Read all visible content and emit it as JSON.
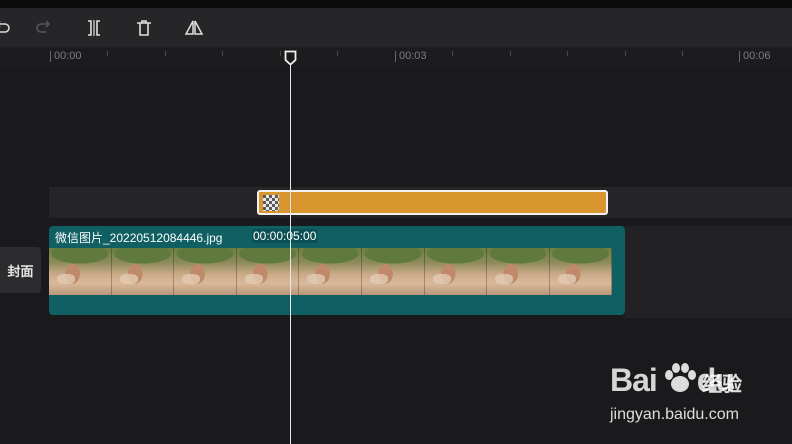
{
  "toolbar": {
    "buttons": [
      {
        "name": "undo",
        "icon": "undo-icon",
        "enabled": true
      },
      {
        "name": "redo",
        "icon": "redo-icon",
        "enabled": false
      },
      {
        "name": "split",
        "icon": "split-icon",
        "enabled": true
      },
      {
        "name": "delete",
        "icon": "delete-icon",
        "enabled": true
      },
      {
        "name": "mirror",
        "icon": "mirror-icon",
        "enabled": true
      }
    ]
  },
  "ruler": {
    "labels": [
      "00:00",
      "00:03",
      "00:06"
    ]
  },
  "timeline": {
    "cover_label": "封面",
    "video_clip": {
      "name": "微信图片_20220512084446.jpg",
      "duration": "00:00:05:00"
    },
    "effect_clip": {
      "color": "#d9962e"
    }
  },
  "watermark": {
    "logo": "Bai",
    "logo_suffix": "du",
    "product": "经验",
    "url": "jingyan.baidu.com"
  },
  "colors": {
    "background": "#1a1a1c",
    "clip_teal": "#0f5f63",
    "effect_orange": "#d9962e",
    "playhead": "#e8e8e8"
  }
}
